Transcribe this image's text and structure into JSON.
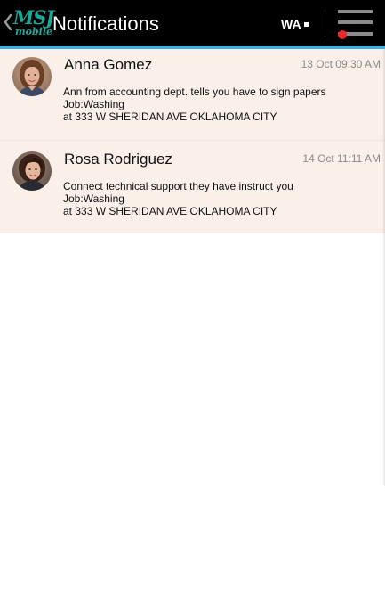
{
  "action_bar": {
    "logo_text": "MSJ",
    "logo_subtext": "mobile",
    "title": "Notifications",
    "state_code": "WA",
    "accent_color": "#34b5e5",
    "logo_color": "#1aa89a",
    "menu_badge_color": "#e8282a"
  },
  "notifications": [
    {
      "sender": "Anna Gomez",
      "timestamp": "13 Oct 09:30 AM",
      "message_line": "Ann from accounting dept. tells you have to sign papers",
      "job_line": "Job:Washing",
      "address_line": "at 333 W SHERIDAN AVE OKLAHOMA CITY",
      "avatar_icon": "woman-portrait"
    },
    {
      "sender": "Rosa Rodriguez",
      "timestamp": "14 Oct 11:11 AM",
      "message_line": "Connect technical support they have instruct you",
      "job_line": "Job:Washing",
      "address_line": "at 333 W SHERIDAN AVE OKLAHOMA CITY",
      "avatar_icon": "woman-portrait"
    }
  ],
  "colors": {
    "item_background": "#fbf0e9",
    "timestamp": "#8a8a8a",
    "bar_background": "#000000"
  }
}
